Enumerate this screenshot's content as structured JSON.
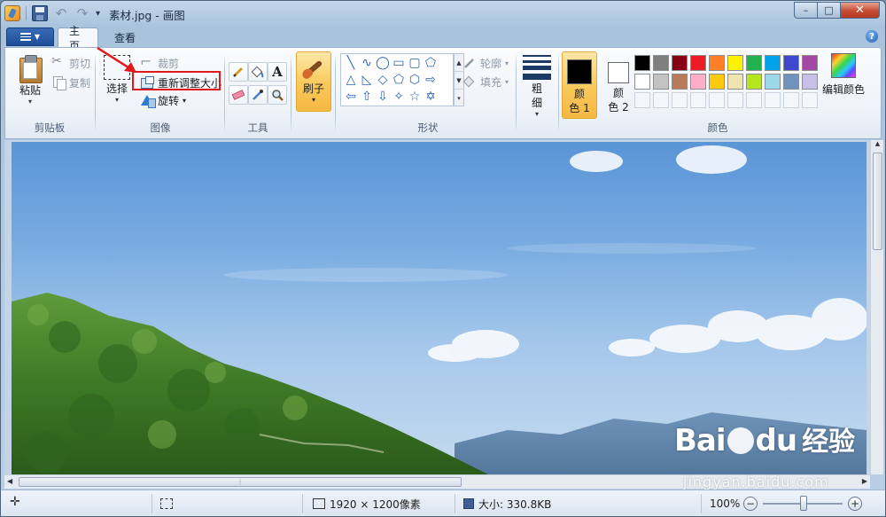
{
  "window": {
    "title": "素材.jpg - 画图",
    "caption": {
      "minimize": "–",
      "maximize": "□",
      "close": "✕"
    }
  },
  "tabs": [
    {
      "label": "主页",
      "active": true
    },
    {
      "label": "查看",
      "active": false
    }
  ],
  "help": "?",
  "ribbon": {
    "clipboard": {
      "label": "剪贴板",
      "paste": "粘贴",
      "cut": "剪切",
      "copy": "复制"
    },
    "image": {
      "label": "图像",
      "select": "选择",
      "crop": "裁剪",
      "resize": "重新调整大小",
      "rotate": "旋转"
    },
    "tools": {
      "label": "工具",
      "icons": [
        "pencil-icon",
        "fill-icon",
        "text-icon",
        "eraser-icon",
        "color-picker-icon",
        "magnifier-icon"
      ],
      "text_glyph": "A"
    },
    "brushes": {
      "label": "刷子"
    },
    "shapes": {
      "label": "形状",
      "outline": "轮廓",
      "fill": "填充"
    },
    "size": {
      "label_line1": "粗",
      "label_line2": "细"
    },
    "colors": {
      "label": "颜色",
      "color1_line1": "颜",
      "color1_line2": "色 1",
      "color2_line1": "颜",
      "color2_line2": "色 2",
      "color1_value": "#000000",
      "color2_value": "#ffffff",
      "edit": "编辑颜色",
      "palette_row1": [
        "#000000",
        "#7f7f7f",
        "#880015",
        "#ed1c24",
        "#ff7f27",
        "#fff200",
        "#22b14c",
        "#00a2e8",
        "#3f48cc",
        "#a349a4"
      ],
      "palette_row2": [
        "#ffffff",
        "#c3c3c3",
        "#b97a57",
        "#ffaec9",
        "#ffc90e",
        "#efe4b0",
        "#b5e61d",
        "#99d9ea",
        "#7092be",
        "#c8bfe7"
      ]
    }
  },
  "status": {
    "dimensions": "1920 × 1200像素",
    "filesize": "大小: 330.8KB",
    "zoom": "100%",
    "zoom_minus": "−",
    "zoom_plus": "+"
  },
  "watermark": {
    "logo": "Bai",
    "logo_tail": "du",
    "text": "经验",
    "url": "jingyan.baidu.com"
  },
  "highlight_color": "#e0191b"
}
